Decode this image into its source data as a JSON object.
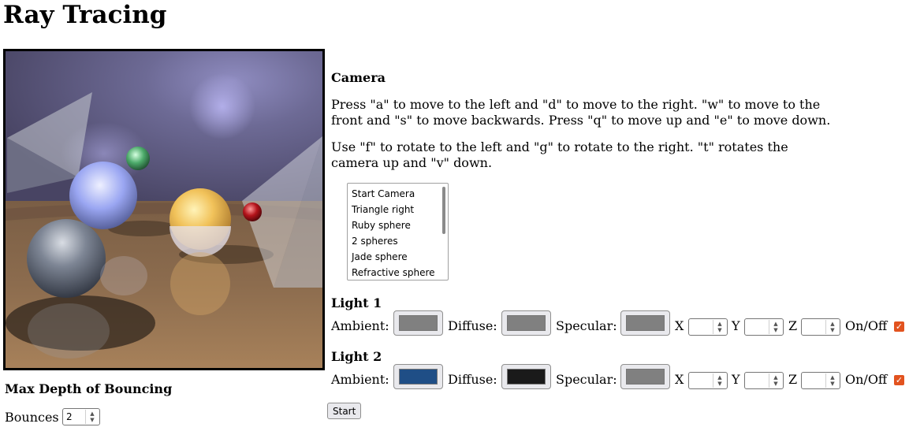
{
  "title": "Ray Tracing",
  "camera": {
    "heading": "Camera",
    "instructions_move": "Press \"a\" to move to the left and \"d\" to move to the right. \"w\" to move to the front and \"s\" to move backwards. Press \"q\" to move up and \"e\" to move down.",
    "instructions_rotate": "Use \"f\" to rotate to the left and \"g\" to rotate to the right. \"t\" rotates the camera up and \"v\" down.",
    "options": [
      "Start Camera",
      "Triangle right",
      "Ruby sphere",
      "2 spheres",
      "Jade sphere",
      "Refractive sphere"
    ]
  },
  "depth": {
    "heading": "Max Depth of Bouncing",
    "bounces_label": "Bounces",
    "bounces_value": "2"
  },
  "lights": [
    {
      "heading": "Light 1",
      "ambient_label": "Ambient:",
      "ambient_color": "#808080",
      "diffuse_label": "Diffuse:",
      "diffuse_color": "#808080",
      "specular_label": "Specular:",
      "specular_color": "#808080",
      "x_label": "X",
      "y_label": "Y",
      "z_label": "Z",
      "x_value": "",
      "y_value": "",
      "z_value": "",
      "onoff_label": "On/Off",
      "enabled": true
    },
    {
      "heading": "Light 2",
      "ambient_label": "Ambient:",
      "ambient_color": "#1f4e86",
      "diffuse_label": "Diffuse:",
      "diffuse_color": "#1a1a1a",
      "specular_label": "Specular:",
      "specular_color": "#808080",
      "x_label": "X",
      "y_label": "Y",
      "z_label": "Z",
      "x_value": "",
      "y_value": "",
      "z_value": "",
      "onoff_label": "On/Off",
      "enabled": true
    }
  ],
  "start_label": "Start",
  "colors": {
    "checkbox_accent": "#e2531f"
  }
}
